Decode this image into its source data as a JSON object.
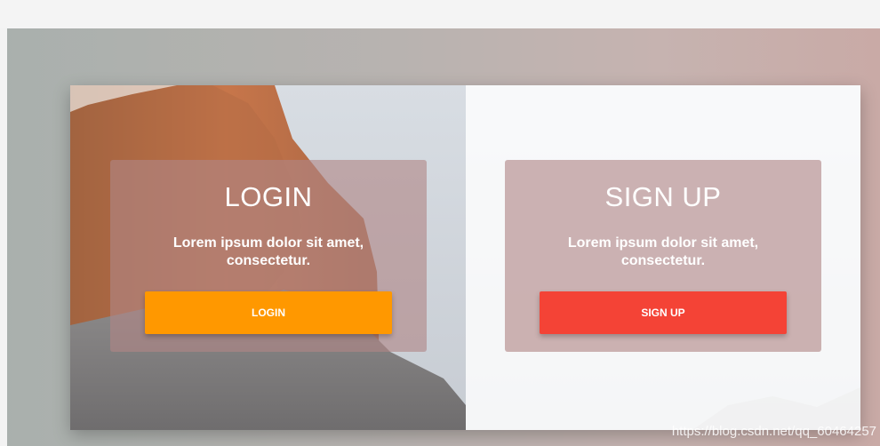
{
  "login_card": {
    "title": "LOGIN",
    "text": "Lorem ipsum dolor sit amet, consectetur.",
    "button_label": "LOGIN"
  },
  "signup_card": {
    "title": "SIGN UP",
    "text": "Lorem ipsum dolor sit amet, consectetur.",
    "button_label": "SIGN UP"
  },
  "watermark": "https://blog.csdn.net/qq_60464257",
  "colors": {
    "login_button": "#ff9800",
    "signup_button": "#f44336",
    "card_overlay": "rgba(176,134,134,0.62)"
  }
}
